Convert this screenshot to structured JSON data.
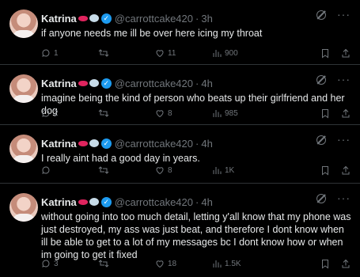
{
  "tweets": [
    {
      "name": "Katrina",
      "handle": "@carrottcake420",
      "time": "3h",
      "text": "if anyone needs me ill be over here icing my throat",
      "replies": "1",
      "retweets": "",
      "likes": "11",
      "views": "900"
    },
    {
      "name": "Katrina",
      "handle": "@carrottcake420",
      "time": "4h",
      "text": "imagine being the kind of person who beats up their girlfriend and her dog",
      "replies": "2",
      "retweets": "",
      "likes": "8",
      "views": "985"
    },
    {
      "name": "Katrina",
      "handle": "@carrottcake420",
      "time": "4h",
      "text": "I really aint had a good day in years.",
      "replies": "",
      "retweets": "",
      "likes": "8",
      "views": "1K"
    },
    {
      "name": "Katrina",
      "handle": "@carrottcake420",
      "time": "4h",
      "text": "without going into too much detail, letting y'all know that my phone was just destroyed, my ass was just beat, and therefore I dont know when ill be able to get to a lot of my messages bc I dont know how or when im going to get it fixed",
      "replies": "3",
      "retweets": "",
      "likes": "18",
      "views": "1.5K"
    }
  ],
  "colors": {
    "background": "#000000",
    "text": "#e7e9ea",
    "muted": "#71767b",
    "verified": "#1d9bf0",
    "divider": "#2f3336"
  }
}
